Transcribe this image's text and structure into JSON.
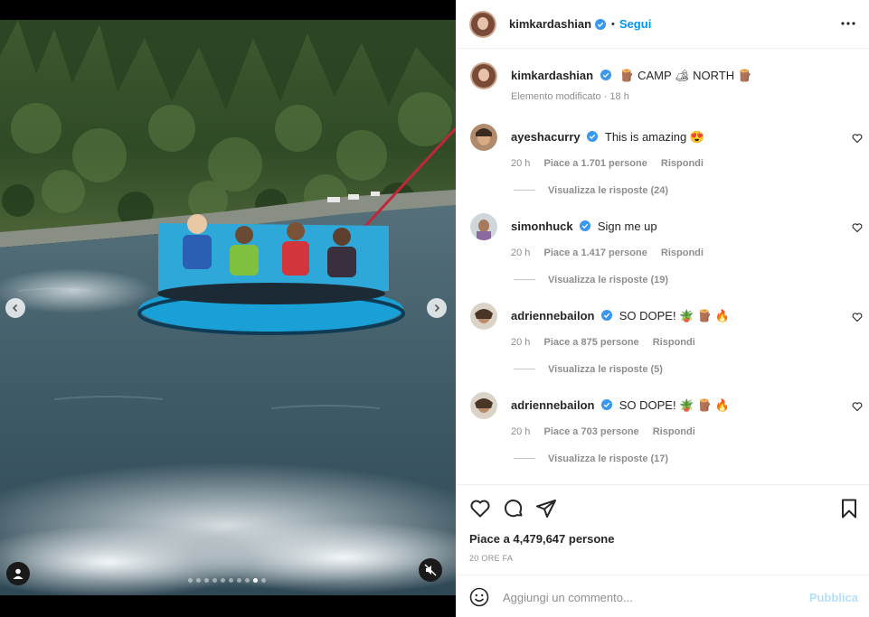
{
  "post": {
    "author": "kimkardashian",
    "follow_label": "Segui",
    "separator": "•",
    "caption": {
      "author": "kimkardashian",
      "text": "🪵 CAMP 🏕 NORTH 🪵",
      "edited": "Elemento modificato · 18 h"
    },
    "comments": [
      {
        "user": "ayeshacurry",
        "text": "This is amazing 😍",
        "time": "20 h",
        "likes": "Piace a 1.701 persone",
        "reply": "Rispondi",
        "replies": "Visualizza le risposte (24)"
      },
      {
        "user": "simonhuck",
        "text": "Sign me up",
        "time": "20 h",
        "likes": "Piace a 1.417 persone",
        "reply": "Rispondi",
        "replies": "Visualizza le risposte (19)"
      },
      {
        "user": "adriennebailon",
        "text": "SO DOPE! 🪴 🪵 🔥",
        "time": "20 h",
        "likes": "Piace a 875 persone",
        "reply": "Rispondi",
        "replies": "Visualizza le risposte (5)"
      },
      {
        "user": "adriennebailon",
        "text": "SO DOPE! 🪴 🪵 🔥",
        "time": "20 h",
        "likes": "Piace a 703 persone",
        "reply": "Rispondi",
        "replies": "Visualizza le risposte (17)"
      }
    ],
    "likes_total": "Piace a 4,479,647 persone",
    "posted_time": "20 ORE FA",
    "composer": {
      "placeholder": "Aggiungi un commento...",
      "publish_label": "Pubblica"
    },
    "media": {
      "slide_count": 10,
      "active_slide": 8
    }
  },
  "icons": {
    "verified": "verified-badge-icon",
    "more": "more-options-icon",
    "like": "heart-icon",
    "comment": "comment-icon",
    "share": "share-icon",
    "save": "bookmark-icon",
    "emoji": "emoji-icon",
    "mute": "muted-speaker-icon",
    "tags": "user-tag-icon",
    "prev": "chevron-left-icon",
    "next": "chevron-right-icon"
  },
  "colors": {
    "accent": "#0095f6",
    "verified": "#3897f0",
    "publish_disabled": "#b2dffc",
    "muted_text": "#8e8e8e"
  }
}
